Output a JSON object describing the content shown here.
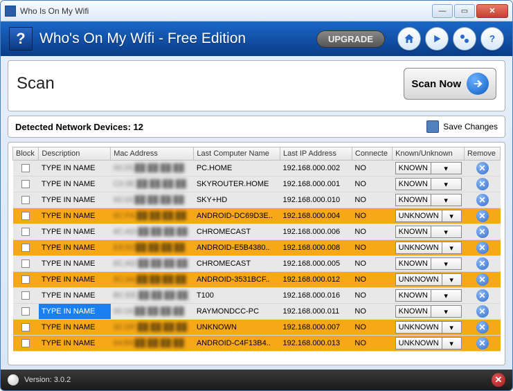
{
  "window": {
    "title": "Who Is On My Wifi"
  },
  "header": {
    "app_title": "Who's On My Wifi -  Free Edition",
    "upgrade": "UPGRADE",
    "buttons": {
      "home": "home-icon",
      "play": "play-icon",
      "settings": "gear-icon",
      "help": "help-icon"
    }
  },
  "scan": {
    "label": "Scan",
    "scan_now": "Scan Now"
  },
  "detected": {
    "label_prefix": "Detected Network Devices: ",
    "count": 12,
    "save_changes": "Save Changes"
  },
  "columns": {
    "block": "Block",
    "description": "Description",
    "mac": "Mac Address",
    "lastname": "Last Computer Name",
    "lastip": "Last IP Address",
    "connected": "Connecte",
    "known": "Known/Unknown",
    "remove": "Remove"
  },
  "rows": [
    {
      "desc": "TYPE IN NAME",
      "mac": "00:25:██:██:██:██",
      "name": "PC.HOME",
      "ip": "192.168.000.002",
      "conn": "NO",
      "known": "KNOWN",
      "highlight": "known"
    },
    {
      "desc": "TYPE IN NAME",
      "mac": "C0:3E:██:██:██:██",
      "name": "SKYROUTER.HOME",
      "ip": "192.168.000.001",
      "conn": "NO",
      "known": "KNOWN",
      "highlight": "known"
    },
    {
      "desc": "TYPE IN NAME",
      "mac": "00:19:██:██:██:██",
      "name": "SKY+HD",
      "ip": "192.168.000.010",
      "conn": "NO",
      "known": "KNOWN",
      "highlight": "known"
    },
    {
      "desc": "TYPE IN NAME",
      "mac": "6C:FA:██:██:██:██",
      "name": "ANDROID-DC69D3E..",
      "ip": "192.168.000.004",
      "conn": "NO",
      "known": "UNKNOWN",
      "highlight": "unknown"
    },
    {
      "desc": "TYPE IN NAME",
      "mac": "6C:AD:██:██:██:██",
      "name": "CHROMECAST",
      "ip": "192.168.000.006",
      "conn": "NO",
      "known": "KNOWN",
      "highlight": "known"
    },
    {
      "desc": "TYPE IN NAME",
      "mac": "E8:50:██:██:██:██",
      "name": "ANDROID-E5B4380..",
      "ip": "192.168.000.008",
      "conn": "NO",
      "known": "UNKNOWN",
      "highlight": "unknown"
    },
    {
      "desc": "TYPE IN NAME",
      "mac": "6C:AD:██:██:██:██",
      "name": "CHROMECAST",
      "ip": "192.168.000.005",
      "conn": "NO",
      "known": "KNOWN",
      "highlight": "known"
    },
    {
      "desc": "TYPE IN NAME",
      "mac": "8C:3A:██:██:██:██",
      "name": "ANDROID-3531BCF..",
      "ip": "192.168.000.012",
      "conn": "NO",
      "known": "UNKNOWN",
      "highlight": "unknown"
    },
    {
      "desc": "TYPE IN NAME",
      "mac": "BC:EE:██:██:██:██",
      "name": "T100",
      "ip": "192.168.000.016",
      "conn": "NO",
      "known": "KNOWN",
      "highlight": "known"
    },
    {
      "desc": "TYPE IN NAME",
      "mac": "00:19:██:██:██:██",
      "name": "RAYMONDCC-PC",
      "ip": "192.168.000.011",
      "conn": "NO",
      "known": "KNOWN",
      "highlight": "known",
      "selected": true
    },
    {
      "desc": "TYPE IN NAME",
      "mac": "3C:DF:██:██:██:██",
      "name": "UNKNOWN",
      "ip": "192.168.000.007",
      "conn": "NO",
      "known": "UNKNOWN",
      "highlight": "unknown"
    },
    {
      "desc": "TYPE IN NAME",
      "mac": "64:89:██:██:██:██",
      "name": "ANDROID-C4F13B4..",
      "ip": "192.168.000.013",
      "conn": "NO",
      "known": "UNKNOWN",
      "highlight": "unknown"
    }
  ],
  "status": {
    "version_label": "Version: ",
    "version": "3.0.2"
  }
}
